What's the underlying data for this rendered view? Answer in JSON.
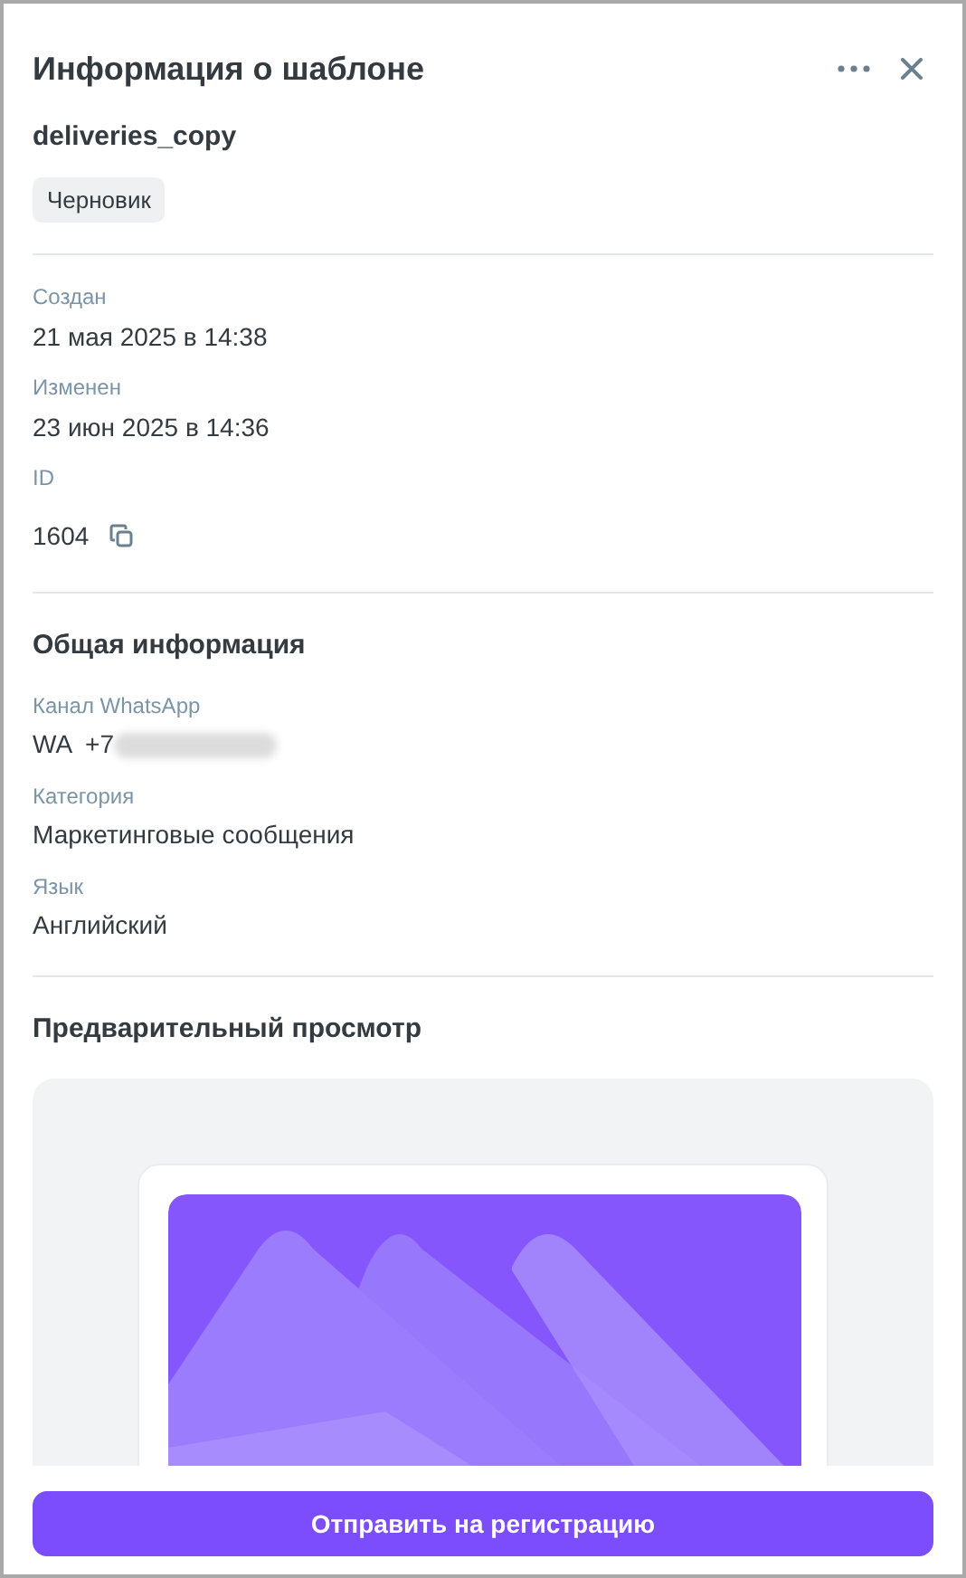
{
  "panel": {
    "title": "Информация о шаблоне",
    "template_name": "deliveries_copy",
    "status": "Черновик"
  },
  "meta": [
    {
      "label": "Создан",
      "value": "21 мая 2025 в 14:38"
    },
    {
      "label": "Изменен",
      "value": "23 июн 2025 в 14:36"
    },
    {
      "label": "ID",
      "value": "1604",
      "kind": "copyable"
    }
  ],
  "general": {
    "heading": "Общая информация",
    "fields": [
      {
        "label": "Канал WhatsApp",
        "value": "WA  +7",
        "kind": "redacted"
      },
      {
        "label": "Категория",
        "value": "Маркетинговые сообщения"
      },
      {
        "label": "Язык",
        "value": "Английский"
      }
    ]
  },
  "preview": {
    "heading": "Предварительный просмотр"
  },
  "submit_button": "Отправить на регистрацию"
}
